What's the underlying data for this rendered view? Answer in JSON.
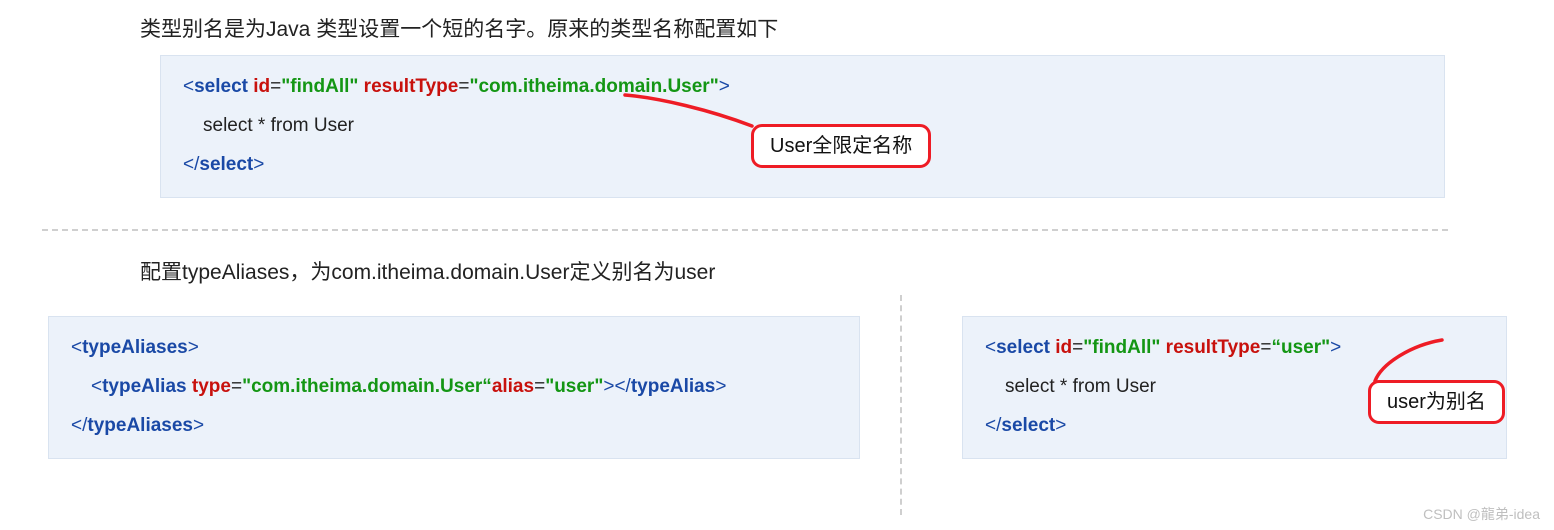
{
  "intro1": "类型别名是为Java 类型设置一个短的名字。原来的类型名称配置如下",
  "code1": {
    "line1": {
      "lt": "<",
      "tag_open": "select",
      "sp1": " ",
      "attr_id": "id",
      "eq1": "=",
      "val_id": "\"findAll\"",
      "sp2": "  ",
      "attr_rt": "resultType",
      "eq2": "=",
      "val_rt": "\"com.itheima.domain.User\"",
      "gt": ">"
    },
    "line2": "select * from User",
    "line3": {
      "lt": "</",
      "tag_close": "select",
      "gt": ">"
    }
  },
  "callout1": "User全限定名称",
  "intro2": "配置typeAliases，为com.itheima.domain.User定义别名为user",
  "code2": {
    "line1": {
      "lt": "<",
      "tag": "typeAliases",
      "gt": ">"
    },
    "line2": {
      "lt": "<",
      "tag_open": "typeAlias",
      "sp1": " ",
      "attr_type": "type",
      "eq1": "=",
      "val_type": "\"com.itheima.domain.User“",
      "attr_alias": "alias",
      "eq2": "=",
      "val_alias": "\"user\"",
      "gt1": ">",
      "lt_close": "</",
      "tag_close": "typeAlias",
      "gt2": ">"
    },
    "line3": {
      "lt": "</",
      "tag": "typeAliases",
      "gt": ">"
    }
  },
  "code3": {
    "line1": {
      "lt": "<",
      "tag_open": "select",
      "sp1": " ",
      "attr_id": "id",
      "eq1": "=",
      "val_id": "\"findAll\"",
      "sp2": "  ",
      "attr_rt": "resultType",
      "eq2": "=",
      "val_rt": "“user\"",
      "gt": ">"
    },
    "line2": "select * from User",
    "line3": {
      "lt": "</",
      "tag_close": "select",
      "gt": ">"
    }
  },
  "callout2": "user为别名",
  "watermark": "CSDN @龍弟-idea"
}
